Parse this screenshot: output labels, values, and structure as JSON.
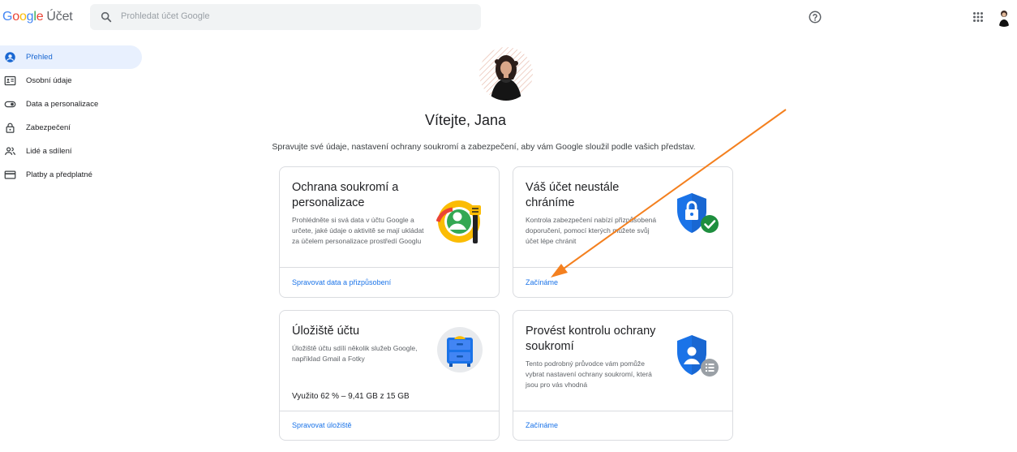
{
  "header": {
    "logo_letters": [
      "G",
      "o",
      "o",
      "g",
      "l",
      "e"
    ],
    "product": "Účet",
    "search_placeholder": "Prohledat účet Google",
    "icons": [
      "search-icon",
      "help-icon",
      "apps-grid-icon",
      "account-avatar"
    ]
  },
  "sidebar": {
    "items": [
      {
        "label": "Přehled",
        "icon": "account-circle-icon",
        "active": true
      },
      {
        "label": "Osobní údaje",
        "icon": "id-card-icon",
        "active": false
      },
      {
        "label": "Data a personalizace",
        "icon": "toggle-icon",
        "active": false
      },
      {
        "label": "Zabezpečení",
        "icon": "lock-icon",
        "active": false
      },
      {
        "label": "Lidé a sdílení",
        "icon": "people-icon",
        "active": false
      },
      {
        "label": "Platby a předplatné",
        "icon": "credit-card-icon",
        "active": false
      }
    ]
  },
  "main": {
    "welcome": "Vítejte, Jana",
    "subtitle": "Spravujte své údaje, nastavení ochrany soukromí a zabezpečení, aby vám Google sloužil podle vašich představ.",
    "cards": [
      {
        "title": "Ochrana soukromí a personalizace",
        "description": "Prohlédněte si svá data v účtu Google a určete, jaké údaje o aktivitě se mají ukládat za účelem personalizace prostředí Googlu",
        "link": "Spravovat data a přizpůsobení",
        "icon": "privacy-personalization-illustration"
      },
      {
        "title": "Váš účet neustále chráníme",
        "description": "Kontrola zabezpečení nabízí přizpůsobená doporučení, pomocí kterých můžete svůj účet lépe chránit",
        "link": "Začínáme",
        "icon": "security-shield-check-illustration"
      },
      {
        "title": "Úložiště účtu",
        "description": "Úložiště účtu sdílí několik služeb Google, například Gmail a Fotky",
        "storage": "Využito 62 % – 9,41 GB z 15 GB",
        "storage_fraction": 0.62,
        "link": "Spravovat úložiště",
        "icon": "storage-drawer-illustration"
      },
      {
        "title": "Provést kontrolu ochrany soukromí",
        "description": "Tento podrobný průvodce vám pomůže vybrat nastavení ochrany soukromí, která jsou pro vás vhodná",
        "link": "Začínáme",
        "icon": "privacy-checkup-shield-illustration"
      }
    ]
  },
  "colors": {
    "accent": "#1a73e8",
    "active_bg": "#e8f0fe",
    "arrow": "#f4801f"
  }
}
